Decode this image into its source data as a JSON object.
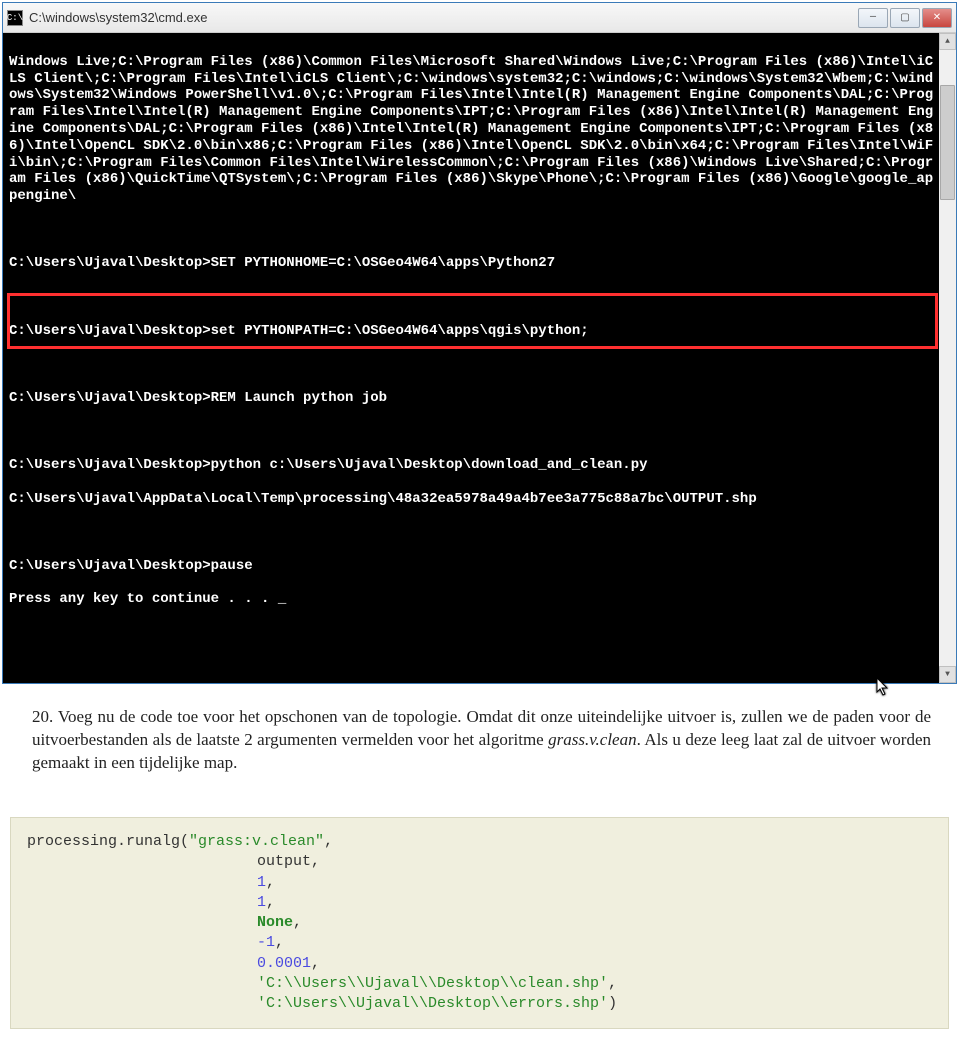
{
  "window": {
    "title": "C:\\windows\\system32\\cmd.exe",
    "icon_text": "C:\\"
  },
  "terminal": {
    "path_block": "Windows Live;C:\\Program Files (x86)\\Common Files\\Microsoft Shared\\Windows Live;C:\\Program Files (x86)\\Intel\\iCLS Client\\;C:\\Program Files\\Intel\\iCLS Client\\;C:\\windows\\system32;C:\\windows;C:\\windows\\System32\\Wbem;C:\\windows\\System32\\Windows PowerShell\\v1.0\\;C:\\Program Files\\Intel\\Intel(R) Management Engine Components\\DAL;C:\\Program Files\\Intel\\Intel(R) Management Engine Components\\IPT;C:\\Program Files (x86)\\Intel\\Intel(R) Management Engine Components\\DAL;C:\\Program Files (x86)\\Intel\\Intel(R) Management Engine Components\\IPT;C:\\Program Files (x86)\\Intel\\OpenCL SDK\\2.0\\bin\\x86;C:\\Program Files (x86)\\Intel\\OpenCL SDK\\2.0\\bin\\x64;C:\\Program Files\\Intel\\WiFi\\bin\\;C:\\Program Files\\Common Files\\Intel\\WirelessCommon\\;C:\\Program Files (x86)\\Windows Live\\Shared;C:\\Program Files (x86)\\QuickTime\\QTSystem\\;C:\\Program Files (x86)\\Skype\\Phone\\;C:\\Program Files (x86)\\Google\\google_appengine\\",
    "line_set_home": "C:\\Users\\Ujaval\\Desktop>SET PYTHONHOME=C:\\OSGeo4W64\\apps\\Python27",
    "line_set_path": "C:\\Users\\Ujaval\\Desktop>set PYTHONPATH=C:\\OSGeo4W64\\apps\\qgis\\python;",
    "line_rem": "C:\\Users\\Ujaval\\Desktop>REM Launch python job",
    "line_python": "C:\\Users\\Ujaval\\Desktop>python c:\\Users\\Ujaval\\Desktop\\download_and_clean.py",
    "line_output_shp": "C:\\Users\\Ujaval\\AppData\\Local\\Temp\\processing\\48a32ea5978a49a4b7ee3a775c88a7bc\\OUTPUT.shp",
    "line_pause": "C:\\Users\\Ujaval\\Desktop>pause",
    "line_anykey": "Press any key to continue . . . _"
  },
  "doc": {
    "item_number": "20.",
    "text_before_italic": "Voeg nu de code toe voor het opschonen van de topologie. Omdat dit onze uiteindelijke uitvoer is, zullen we de paden voor de uitvoerbestanden als de laatste 2 argumenten vermelden voor het algoritme ",
    "italic_word": "grass.v.clean",
    "text_after_italic": ". Als u deze leeg laat zal de uitvoer worden gemaakt in een tijdelijke map."
  },
  "code": {
    "call": "processing.runalg(",
    "arg0": "\"grass:v.clean\"",
    "comma": ",",
    "arg1": "output",
    "arg2": "1",
    "arg3": "1",
    "arg4": "None",
    "arg5": "-1",
    "arg6": "0.0001",
    "arg7": "'C:\\\\Users\\\\Ujaval\\\\Desktop\\\\clean.shp'",
    "arg8": "'C:\\Users\\\\Ujaval\\\\Desktop\\\\errors.shp'",
    "close": ")"
  }
}
